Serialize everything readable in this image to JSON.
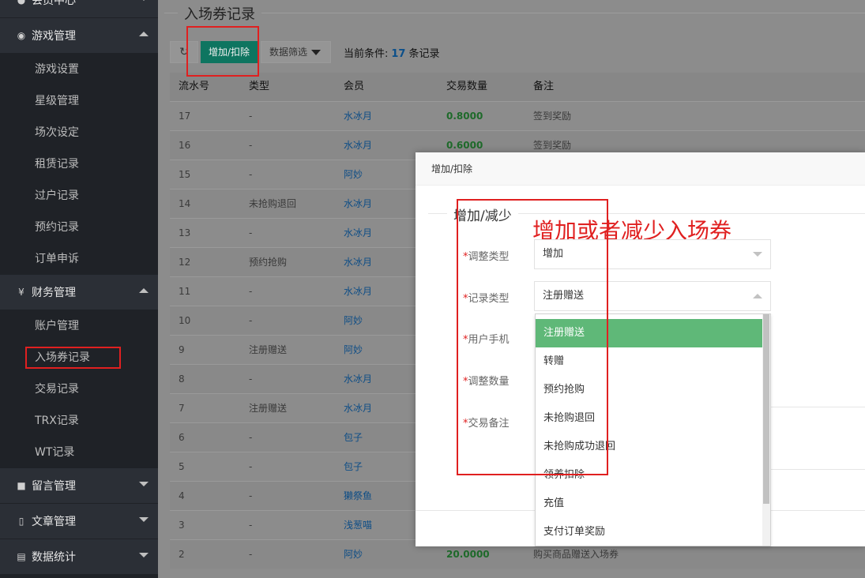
{
  "sidebar": {
    "groups": [
      {
        "icon": "user-icon",
        "label": "会员中心"
      },
      {
        "icon": "gamepad-icon",
        "label": "游戏管理"
      },
      {
        "icon": "yen-icon",
        "icon_glyph": "¥",
        "label": "财务管理"
      },
      {
        "icon": "comment-icon",
        "label": "留言管理"
      },
      {
        "icon": "file-icon",
        "label": "文章管理"
      },
      {
        "icon": "bar-chart-icon",
        "label": "数据统计"
      }
    ],
    "game_items": [
      "游戏设置",
      "星级管理",
      "场次设定",
      "租赁记录",
      "过户记录",
      "预约记录",
      "订单申诉"
    ],
    "finance_items": [
      "账户管理",
      "入场券记录",
      "交易记录",
      "TRX记录",
      "WT记录"
    ]
  },
  "page": {
    "title": "入场券记录"
  },
  "toolbar": {
    "add_label": "增加/扣除",
    "filter_label": "数据筛选",
    "condition_prefix": "当前条件:",
    "record_count": "17",
    "condition_suffix": "条记录"
  },
  "table": {
    "headers": [
      "流水号",
      "类型",
      "会员",
      "交易数量",
      "备注"
    ],
    "rows": [
      [
        "17",
        "-",
        "水冰月",
        "0.8000",
        "签到奖励"
      ],
      [
        "16",
        "-",
        "水冰月",
        "0.6000",
        "签到奖励"
      ],
      [
        "15",
        "-",
        "阿妙",
        "",
        ""
      ],
      [
        "14",
        "未抢购退回",
        "水冰月",
        "",
        ""
      ],
      [
        "13",
        "-",
        "水冰月",
        "",
        ""
      ],
      [
        "12",
        "预约抢购",
        "水冰月",
        "",
        ""
      ],
      [
        "11",
        "-",
        "水冰月",
        "",
        ""
      ],
      [
        "10",
        "-",
        "阿妙",
        "",
        ""
      ],
      [
        "9",
        "注册赠送",
        "阿妙",
        "",
        ""
      ],
      [
        "8",
        "-",
        "水冰月",
        "",
        ""
      ],
      [
        "7",
        "注册赠送",
        "水冰月",
        "",
        ""
      ],
      [
        "6",
        "-",
        "包子",
        "",
        ""
      ],
      [
        "5",
        "-",
        "包子",
        "",
        ""
      ],
      [
        "4",
        "-",
        "獭祭鱼",
        "",
        ""
      ],
      [
        "3",
        "-",
        "浅葱喵",
        "",
        ""
      ],
      [
        "2",
        "-",
        "阿妙",
        "20.0000",
        "购买商品赠送入场券"
      ]
    ]
  },
  "modal": {
    "title": "增加/扣除",
    "legend": "增加/减少",
    "annotation": "增加或者减少入场券",
    "fields": [
      {
        "label": "调整类型",
        "value": "增加"
      },
      {
        "label": "记录类型",
        "value": "注册赠送"
      },
      {
        "label": "用户手机"
      },
      {
        "label": "调整数量"
      },
      {
        "label": "交易备注"
      }
    ],
    "required_mark": "*",
    "dropdown_options": [
      "注册赠送",
      "转赠",
      "预约抢购",
      "未抢购退回",
      "未抢购成功退回",
      "领养扣除",
      "充值",
      "支付订单奖励"
    ]
  },
  "colors": {
    "primary_button": "#0e7560",
    "dropdown_selected": "#5fb878",
    "annotation_red": "#e02020"
  }
}
